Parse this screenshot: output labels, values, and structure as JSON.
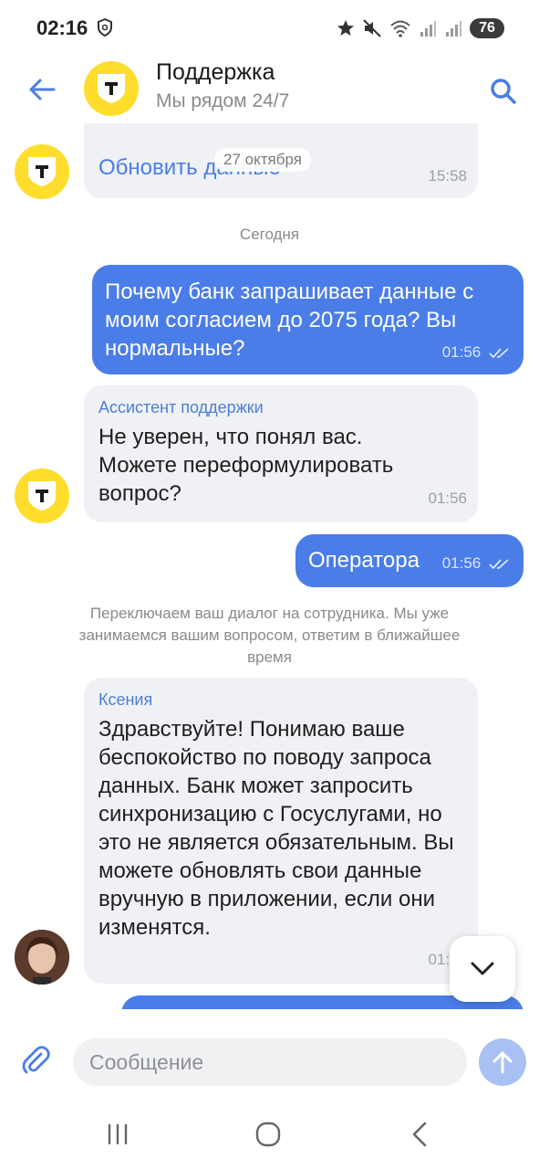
{
  "status_bar": {
    "time": "02:16",
    "battery": "76"
  },
  "header": {
    "title": "Поддержка",
    "subtitle": "Мы рядом 24/7"
  },
  "chat": {
    "messages": [
      {
        "direction": "incoming",
        "text": "Обновить данные",
        "time": "15:58",
        "date_overlay": "27 октября"
      },
      {
        "direction": "divider",
        "text": "Сегодня"
      },
      {
        "direction": "outgoing",
        "text": "Почему банк запрашивает данные с моим согласием до 2075 года? Вы нормальные?",
        "time": "01:56"
      },
      {
        "direction": "incoming",
        "sender": "Ассистент поддержки",
        "text": "Не уверен, что понял вас. Можете переформулировать вопрос?",
        "time": "01:56"
      },
      {
        "direction": "outgoing",
        "text": "Оператора",
        "time": "01:56"
      },
      {
        "direction": "system",
        "text": "Переключаем ваш диалог на сотрудника. Мы уже занимаемся вашим вопросом, ответим в ближайшее время"
      },
      {
        "direction": "incoming",
        "sender": "Ксения",
        "text": "Здравствуйте! Понимаю ваше беспокойство по поводу запроса данных. Банк может запросить синхронизацию с Госуслугами, но это не является обязательным. Вы можете обновлять свои данные вручную в приложении, если они изменятся.",
        "time": "01:56"
      }
    ]
  },
  "composer": {
    "placeholder": "Сообщение"
  },
  "colors": {
    "accent": "#4a7de8",
    "brand_yellow": "#ffdd2d",
    "incoming_bubble": "#eff1f4",
    "sender_name": "#4b7fd8"
  },
  "icons": {
    "back": "arrow-left-icon",
    "search": "search-icon",
    "attach": "paperclip-icon",
    "send": "arrow-up-icon",
    "scroll": "chevron-down-icon"
  }
}
